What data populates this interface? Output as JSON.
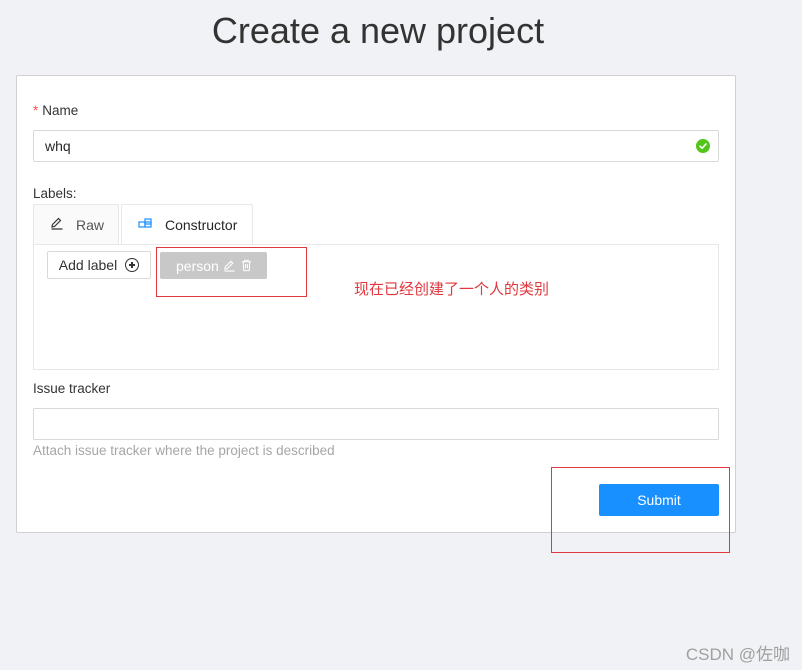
{
  "page": {
    "title": "Create a new project"
  },
  "form": {
    "name": {
      "required_mark": "*",
      "label": "Name",
      "value": "whq",
      "status_icon": "check-circle-icon"
    },
    "labels": {
      "label": "Labels:",
      "tabs": [
        {
          "label": "Raw",
          "icon": "edit-icon"
        },
        {
          "label": "Constructor",
          "icon": "blocks-icon"
        }
      ],
      "active_tab": "Constructor",
      "add_label_button": "Add label",
      "items": [
        {
          "name": "person"
        }
      ]
    },
    "issue_tracker": {
      "label": "Issue tracker",
      "value": "",
      "help": "Attach issue tracker where the project is described"
    },
    "submit_label": "Submit"
  },
  "annotation": {
    "text": "现在已经创建了一个人的类别",
    "color": "#e0383e"
  },
  "watermark": "CSDN @佐咖",
  "colors": {
    "primary": "#1890ff",
    "success": "#52c41a",
    "required": "#ff4d4f",
    "annotation": "#e0383e"
  }
}
